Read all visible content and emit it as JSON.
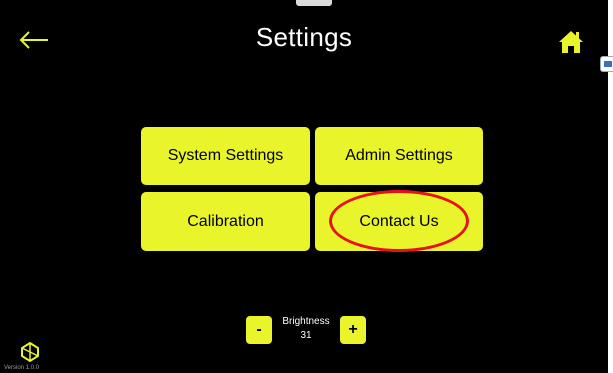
{
  "header": {
    "title": "Settings",
    "back_icon": "arrow-left-icon",
    "home_icon": "home-icon"
  },
  "menu": {
    "items": [
      {
        "label": "System Settings"
      },
      {
        "label": "Admin Settings"
      },
      {
        "label": "Calibration"
      },
      {
        "label": "Contact Us",
        "highlighted": true
      }
    ]
  },
  "brightness": {
    "label": "Brightness",
    "value": "31",
    "decrease_label": "-",
    "increase_label": "+"
  },
  "footer": {
    "version": "Version 1.0.0",
    "logo_icon": "brand-logo-icon"
  },
  "colors": {
    "background": "#000000",
    "accent": "#e9f52a",
    "highlight_ring": "#e8111a",
    "text": "#ffffff"
  }
}
